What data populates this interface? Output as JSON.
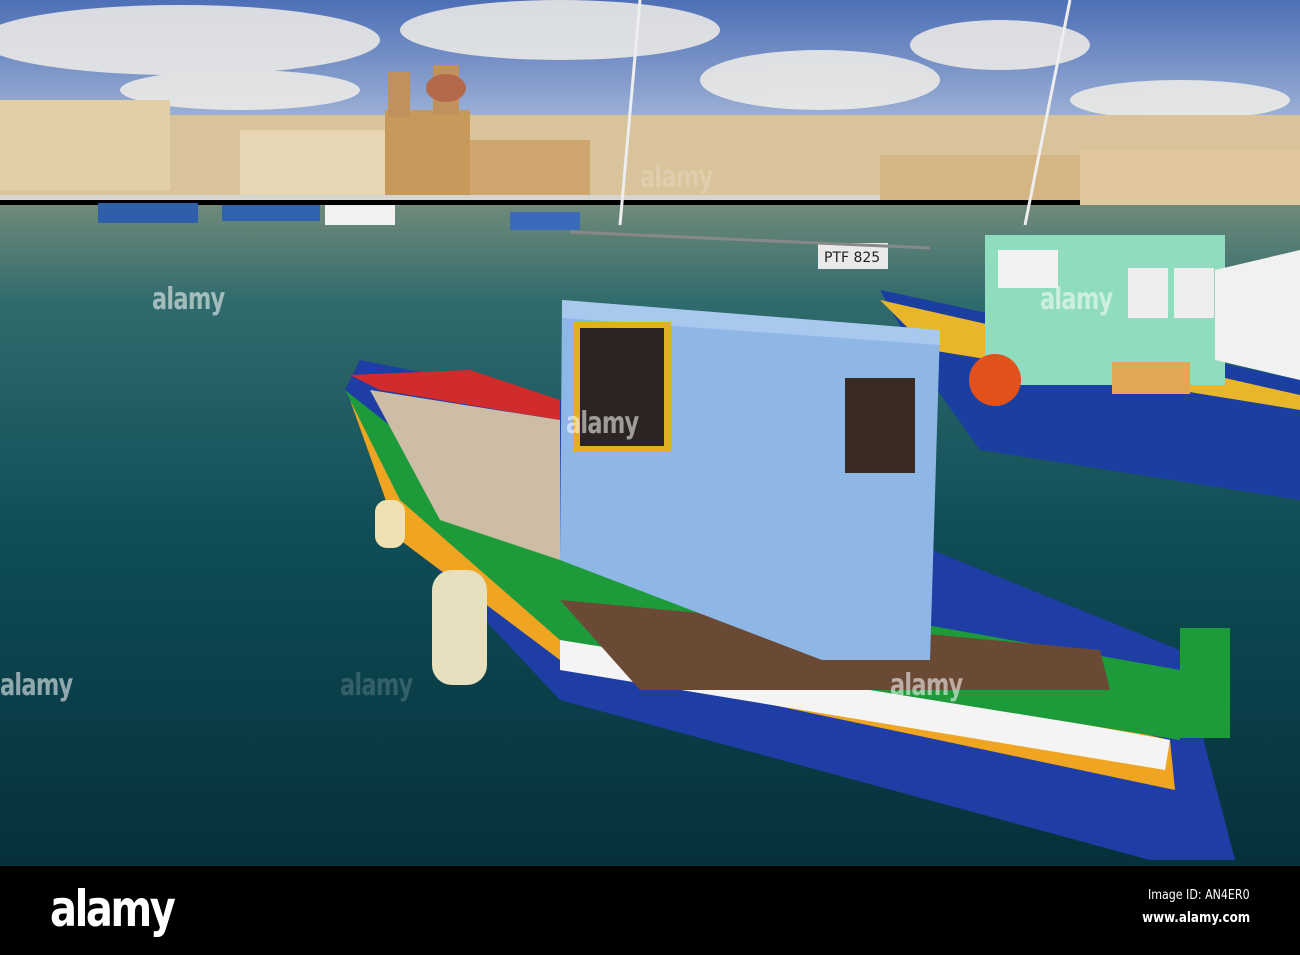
{
  "photo": {
    "subject": "Fishing boats in harbour",
    "boat_registration": "PTF 825"
  },
  "watermarks": [
    "alamy",
    "alamy",
    "alamy",
    "alamy",
    "alamy",
    "alamy",
    "alamy"
  ],
  "footer": {
    "logo": "alamy",
    "image_id": "Image ID: AN4ER0",
    "website": "www.alamy.com"
  },
  "colors": {
    "sky": "#6b8fc9",
    "water": "#0f4a52",
    "cabin": "#8fb7e6",
    "hull_blue": "#1d3c9a",
    "hull_green": "#1d9a3a",
    "hull_yellow": "#e8a922"
  }
}
